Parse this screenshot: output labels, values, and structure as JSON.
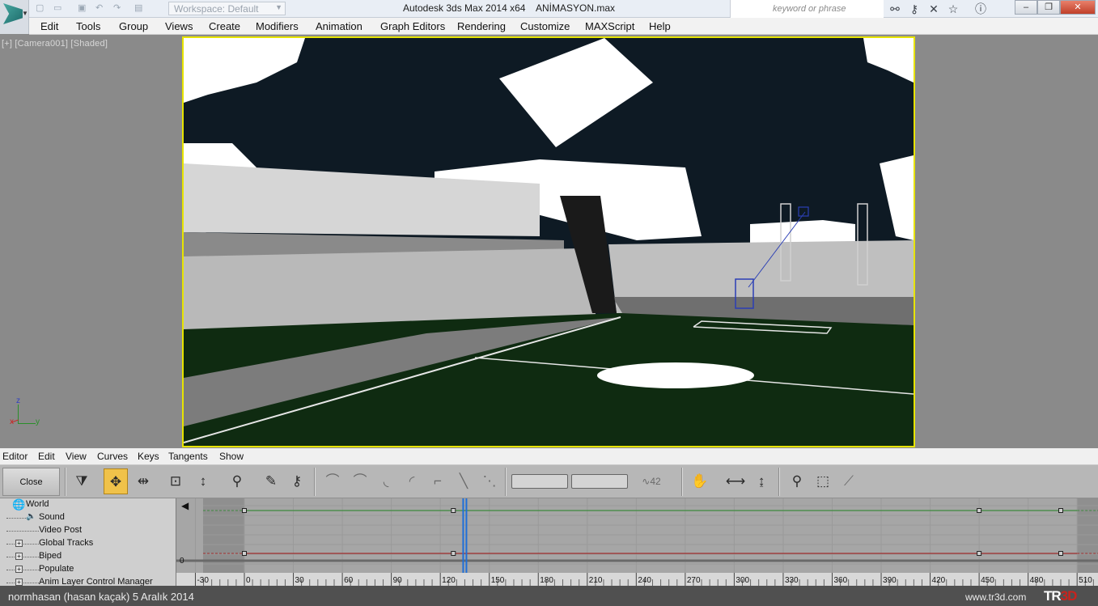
{
  "titlebar": {
    "workspace": "Workspace: Default",
    "app_title": "Autodesk 3ds Max  2014 x64",
    "file_name": "ANİMASYON.max",
    "search_placeholder": "keyword or phrase",
    "minimize": "–",
    "restore": "❐",
    "close": "✕"
  },
  "menu": [
    "Edit",
    "Tools",
    "Group",
    "Views",
    "Create",
    "Modifiers",
    "Animation",
    "Graph Editors",
    "Rendering",
    "Customize",
    "MAXScript",
    "Help"
  ],
  "viewport": {
    "label": "[+] [Camera001] [Shaded]",
    "axis_x": "x",
    "axis_y": "y",
    "axis_z": "z",
    "border_color": "#e7e400",
    "pitch_color": "#0f2b11"
  },
  "track_editor": {
    "menu": [
      "Editor",
      "Edit",
      "View",
      "Curves",
      "Keys",
      "Tangents",
      "Show"
    ],
    "close_label": "Close",
    "lock_value_label": "42",
    "tree": [
      {
        "label": "World",
        "indent": 0,
        "expand": false
      },
      {
        "label": "Sound",
        "indent": 1,
        "expand": false
      },
      {
        "label": "Video Post",
        "indent": 1,
        "expand": false
      },
      {
        "label": "Global Tracks",
        "indent": 1,
        "expand": true
      },
      {
        "label": "Biped",
        "indent": 1,
        "expand": true
      },
      {
        "label": "Populate",
        "indent": 1,
        "expand": true
      },
      {
        "label": "Anim Layer Control Manager",
        "indent": 1,
        "expand": true
      }
    ],
    "value_label": "0",
    "ruler": [
      -30,
      0,
      30,
      60,
      90,
      120,
      150,
      180,
      210,
      240,
      270,
      300,
      330,
      360,
      390,
      420,
      450,
      480,
      510
    ],
    "time_range": [
      0,
      510
    ],
    "current_frame": 135,
    "keys_frames": [
      0,
      128,
      450,
      500
    ],
    "green_color": "#3c8a3c",
    "red_color": "#a02c2c",
    "time_slider_color": "#1f6fd8"
  },
  "status": {
    "left": "normhasan (hasan kaçak)  5 Aralık 2014",
    "right": "www.tr3d.com",
    "logo_a": "TR",
    "logo_b": "3D"
  }
}
